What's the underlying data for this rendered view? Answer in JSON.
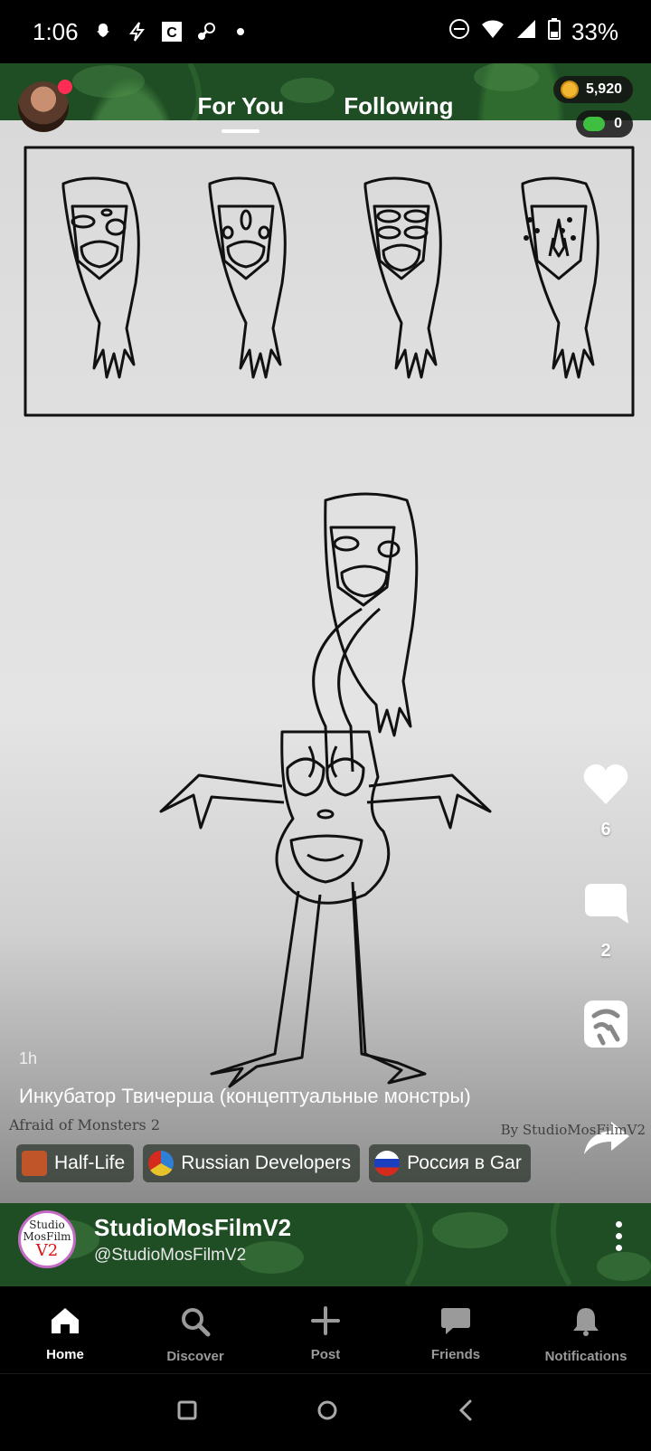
{
  "status_bar": {
    "time": "1:06",
    "battery": "33%",
    "icons": [
      "snapchat-icon",
      "bolt-icon",
      "c-icon",
      "steam-icon",
      "dot-icon",
      "dnd-icon",
      "wifi-icon",
      "signal-icon",
      "battery-icon"
    ]
  },
  "header": {
    "tabs": [
      {
        "label": "For You",
        "active": true
      },
      {
        "label": "Following",
        "active": false
      }
    ],
    "coins": "5,920",
    "gems": "0"
  },
  "post": {
    "time_ago": "1h",
    "caption": "Инкубатор Твичерша (концептуальные монстры)",
    "watermark_left": "Afraid of Monsters 2",
    "watermark_right": "By StudioMosFilmV2",
    "likes": "6",
    "comments": "2",
    "chips": [
      {
        "label": "Half-Life",
        "icon": "half-life-icon",
        "color": "#c0552a"
      },
      {
        "label": "Russian Developers",
        "icon": "rd-logo-icon",
        "color": "#2f7fd6"
      },
      {
        "label": "Россия в Gar",
        "icon": "russia-flag-icon",
        "color": "#d52b1e"
      }
    ]
  },
  "creator": {
    "name": "StudioMosFilmV2",
    "handle": "@StudioMosFilmV2",
    "avatar_line1": "Studio",
    "avatar_line2": "MosFilm",
    "avatar_line3": "V2"
  },
  "nav": {
    "items": [
      {
        "label": "Home",
        "icon": "home-icon",
        "active": true
      },
      {
        "label": "Discover",
        "icon": "search-icon",
        "active": false
      },
      {
        "label": "Post",
        "icon": "plus-icon",
        "active": false
      },
      {
        "label": "Friends",
        "icon": "chat-icon",
        "active": false
      },
      {
        "label": "Notifications",
        "icon": "bell-icon",
        "active": false
      }
    ]
  }
}
